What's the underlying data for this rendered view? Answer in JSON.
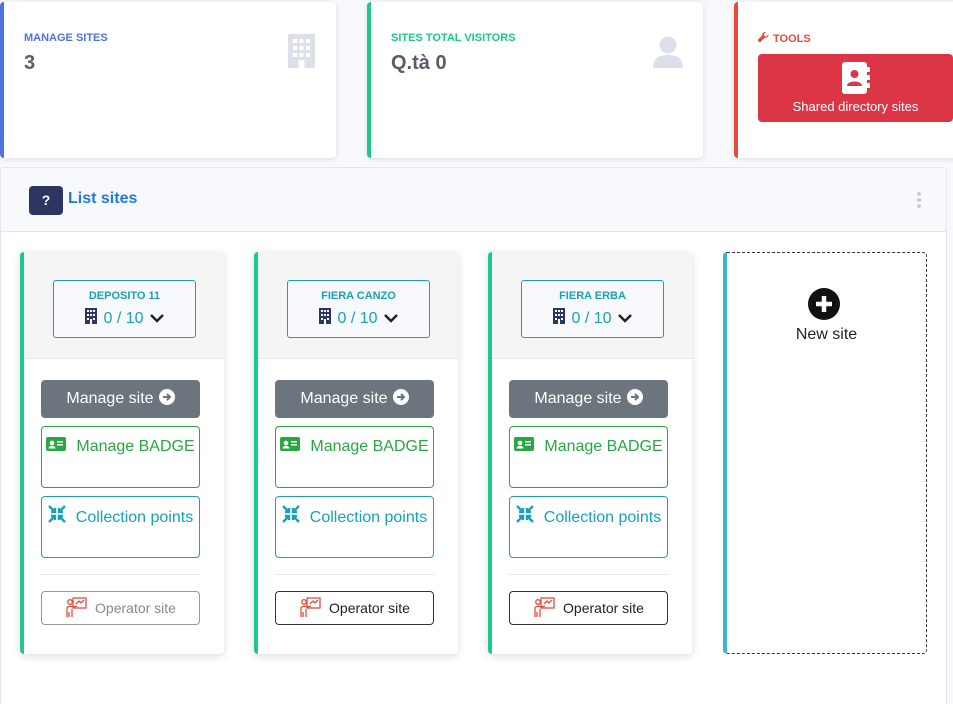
{
  "stats": {
    "manage_sites": {
      "label": "MANAGE SITES",
      "value": "3"
    },
    "visitors": {
      "label": "SITES TOTAL VISITORS",
      "value": "Q.tà 0"
    },
    "tools": {
      "label": "TOOLS",
      "button_label": "Shared directory sites"
    }
  },
  "panel": {
    "help": "?",
    "title": "List sites"
  },
  "sites": [
    {
      "name": "DEPOSITO 11",
      "count": "0 / 10",
      "manage_label": "Manage site",
      "badge_label": "Manage BADGE",
      "collection_label": "Collection points",
      "operator_label": "Operator site",
      "operator_disabled": true
    },
    {
      "name": "FIERA CANZO",
      "count": "0 / 10",
      "manage_label": "Manage site",
      "badge_label": "Manage BADGE",
      "collection_label": "Collection points",
      "operator_label": "Operator site",
      "operator_disabled": false
    },
    {
      "name": "FIERA ERBA",
      "count": "0 / 10",
      "manage_label": "Manage site",
      "badge_label": "Manage BADGE",
      "collection_label": "Collection points",
      "operator_label": "Operator site",
      "operator_disabled": false
    }
  ],
  "new_site": {
    "label": "New site"
  },
  "colors": {
    "primary": "#4e73df",
    "success": "#1cc88a",
    "danger": "#e74a3b",
    "info": "#17a2b8",
    "dark": "#2d3561"
  }
}
